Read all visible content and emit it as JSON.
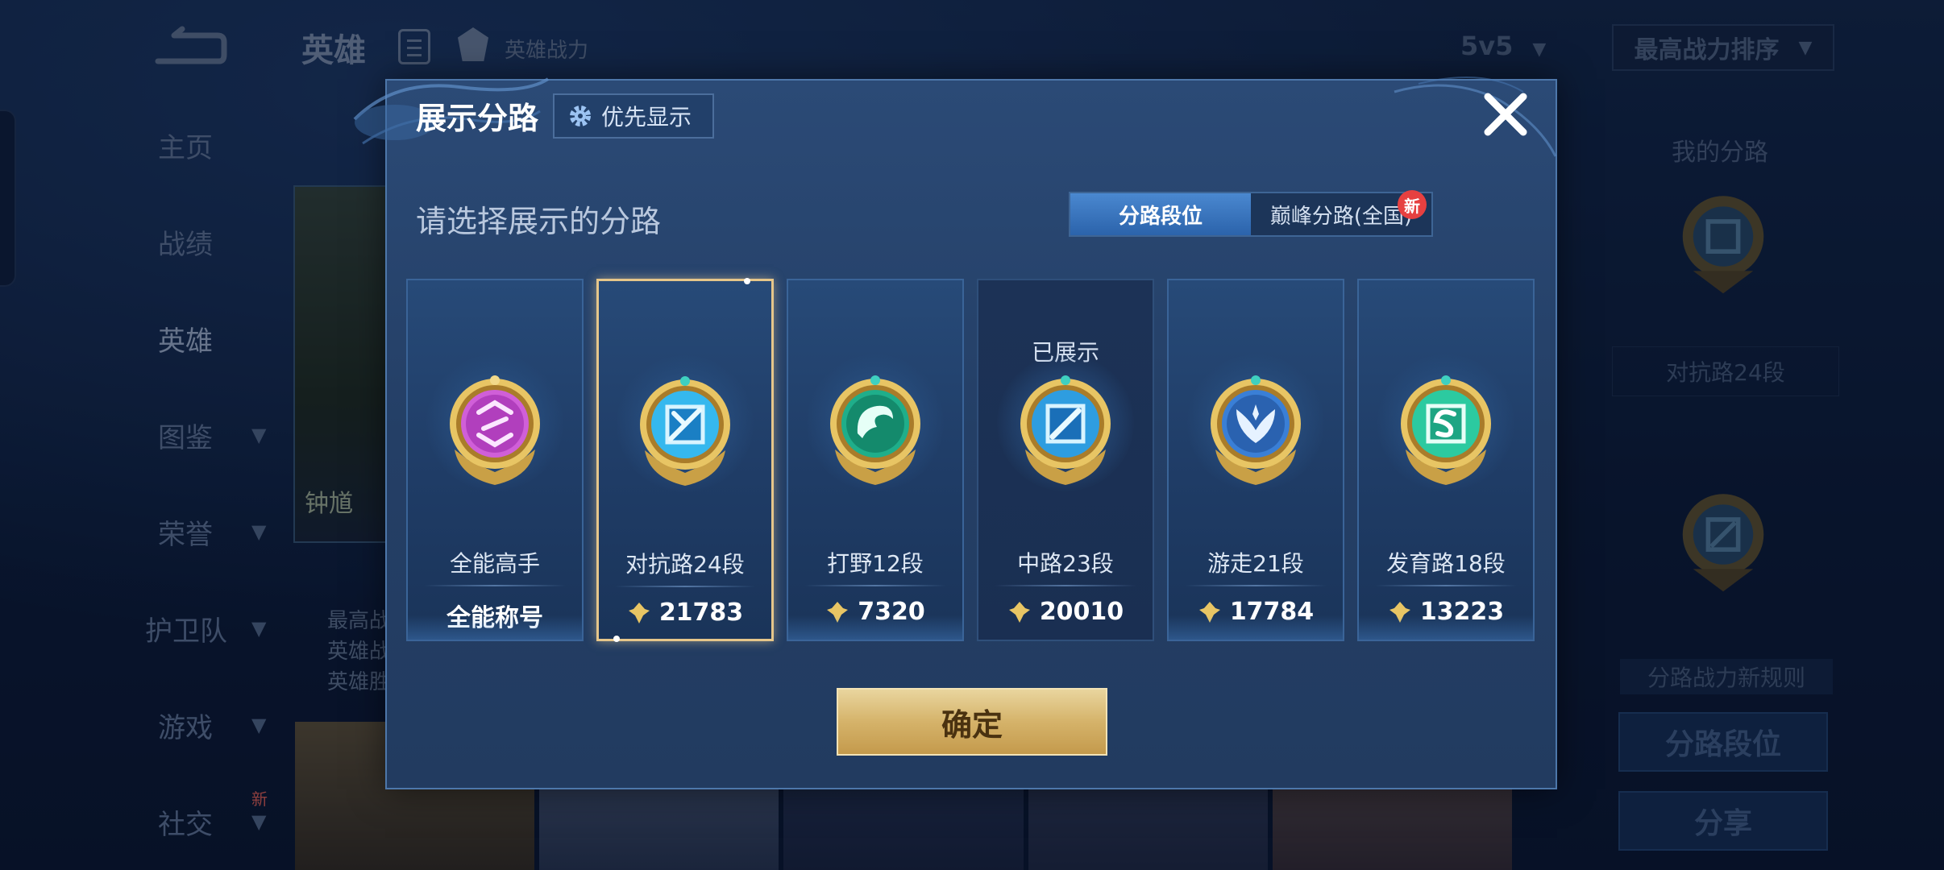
{
  "background": {
    "title": "英雄",
    "power_label": "英雄战力",
    "sidebar": [
      {
        "label": "主页",
        "chevron": false
      },
      {
        "label": "战绩",
        "chevron": false
      },
      {
        "label": "英雄",
        "chevron": false,
        "active": true
      },
      {
        "label": "图鉴",
        "chevron": true
      },
      {
        "label": "荣誉",
        "chevron": true
      },
      {
        "label": "护卫队",
        "chevron": true
      },
      {
        "label": "游戏",
        "chevron": true
      },
      {
        "label": "社交",
        "chevron": true,
        "new": "新"
      }
    ],
    "hero_name": "钟馗",
    "hero_info": [
      "最高战",
      "英雄战",
      "英雄胜"
    ],
    "mode": "5v5",
    "sort": "最高战力排序",
    "right_panel": {
      "title": "我的分路",
      "lane_label": "对抗路24段",
      "rule_label": "分路战力新规则",
      "lane_rank_button": "分路段位",
      "share_button": "分享"
    }
  },
  "modal": {
    "title": "展示分路",
    "priority_button": "优先显示",
    "subtitle": "请选择展示的分路",
    "tabs": {
      "active": "分路段位",
      "other": "巅峰分路(全国)",
      "new_badge": "新"
    },
    "lanes": [
      {
        "name": "全能高手",
        "value": "全能称号",
        "icon": "all-round-badge-icon",
        "color": "#c94fd0",
        "selected": false,
        "shown": false
      },
      {
        "name": "对抗路24段",
        "value": "21783",
        "icon": "clash-lane-badge-icon",
        "color": "#35b8ee",
        "selected": true,
        "shown": false
      },
      {
        "name": "打野12段",
        "value": "7320",
        "icon": "jungle-badge-icon",
        "color": "#1fae8a",
        "selected": false,
        "shown": false
      },
      {
        "name": "中路23段",
        "value": "20010",
        "icon": "mid-lane-badge-icon",
        "color": "#2e9de0",
        "selected": false,
        "shown": true,
        "shown_label": "已展示"
      },
      {
        "name": "游走21段",
        "value": "17784",
        "icon": "roam-badge-icon",
        "color": "#3a7fd6",
        "selected": false,
        "shown": false
      },
      {
        "name": "发育路18段",
        "value": "13223",
        "icon": "farm-lane-badge-icon",
        "color": "#2ccaa0",
        "selected": false,
        "shown": false
      }
    ],
    "confirm_button": "确定"
  }
}
